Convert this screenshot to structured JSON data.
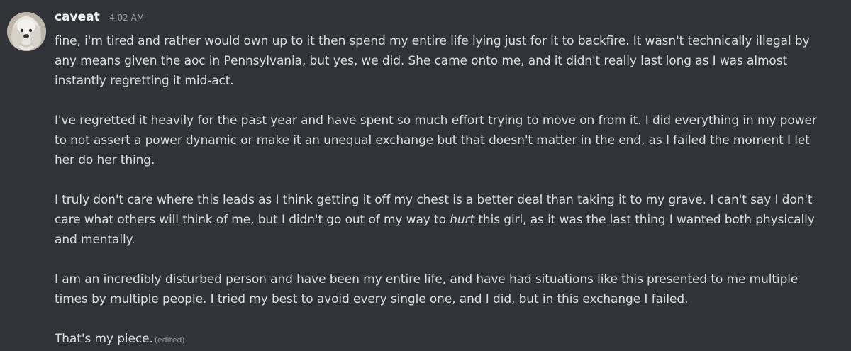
{
  "message": {
    "username": "caveat",
    "timestamp": "4:02 AM",
    "edited_label": "(edited)",
    "paragraphs": {
      "p1": "fine, i'm tired and rather would own up to it then spend my entire life lying just for it to backfire. It wasn't technically illegal by any means given the aoc in Pennsylvania, but yes, we did. She came onto me, and it didn't really last long as I was almost instantly regretting it mid-act.",
      "p2": "I've regretted it heavily for the past year and have spent so much effort trying to move on from it. I did everything in my power to not assert a power dynamic or make it an unequal exchange but that doesn't matter in the end, as I failed the moment I let her do her thing.",
      "p3_before": "I truly don't care where this leads as I think getting it off my chest is a better deal than taking it to my grave. I can't say I don't care what others will think of me, but I didn't go out of my way to ",
      "p3_emphasis": "hurt",
      "p3_after": " this girl, as it was the last thing I wanted both physically and mentally.",
      "p4": "I am an incredibly disturbed person and have been my entire life, and have had situations like this presented to me multiple times by multiple people. I tried my best to avoid every single one, and I did, but in this exchange I failed.",
      "p5": "That's my piece."
    }
  }
}
